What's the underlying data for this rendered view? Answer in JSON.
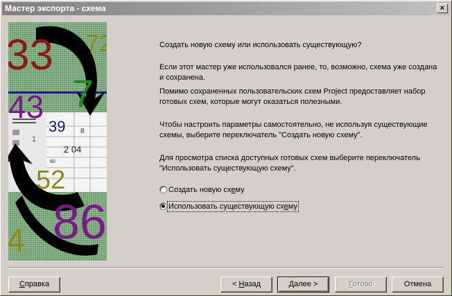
{
  "window": {
    "title": "Мастер экспорта - схема",
    "close_label": "×"
  },
  "art": {
    "numbers": [
      "33",
      "72",
      "7",
      "43",
      "39",
      "8",
      "1",
      "2 04",
      "60",
      "52",
      "86",
      "4"
    ]
  },
  "content": {
    "question": "Создать новую схему или использовать существующую?",
    "p1": "Если этот мастер уже использовался ранее, то, возможно, схема уже создана и сохранена.",
    "p2": "Помимо сохраненных пользовательских схем Project предоставляет набор готовых схем, которые могут оказаться полезными.",
    "p3": "Чтобы настроить параметры самостоятельно, не используя существующие схемы, выберите переключатель \"Создать новую схему\".",
    "p4": "Для просмотра списка доступных готовых схем выберите переключатель \"Использовать существующую схему\"."
  },
  "options": {
    "new_scheme": {
      "label_pre": "Создать новую сх",
      "label_u": "е",
      "label_post": "му",
      "selected": false
    },
    "existing_scheme": {
      "label_pre": "Использовать существующую сх",
      "label_u": "е",
      "label_post": "му",
      "selected": true
    }
  },
  "buttons": {
    "help": {
      "u": "С",
      "rest": "правка"
    },
    "back": {
      "pre": "< ",
      "u": "Н",
      "rest": "азад"
    },
    "next": {
      "pre": "",
      "u": "Д",
      "rest": "алее >"
    },
    "finish": {
      "u": "Г",
      "rest": "отово",
      "enabled": false
    },
    "cancel": {
      "label": "Отмена"
    }
  },
  "colors": {
    "accent_purple": "#7a1a8a",
    "accent_green": "#1f8a1f",
    "accent_olive": "#8a8a1f",
    "accent_red": "#8a1a1a"
  }
}
